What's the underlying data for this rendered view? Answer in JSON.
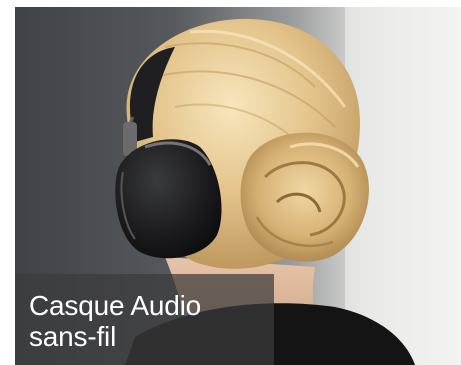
{
  "banner": {
    "caption_line1": "Casque Audio",
    "caption_line2": "sans-fil"
  },
  "colors": {
    "background": "#ffffff",
    "caption_overlay": "#3c3c3c",
    "caption_text": "#ffffff",
    "hair": "#e8c98e",
    "headphone": "#1b1b1c"
  }
}
